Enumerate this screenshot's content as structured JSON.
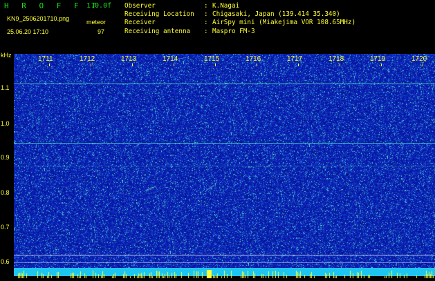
{
  "app": {
    "title": "H R O F F T",
    "version": "1.0.0f",
    "filename": "KN9_2506201710.png",
    "mode": "meteor",
    "datetime": "25.06.20 17:10",
    "count": "97"
  },
  "info": [
    {
      "key": "Observer",
      "sep": ":",
      "value": "K.Nagai"
    },
    {
      "key": "Receiving Location",
      "sep": ":",
      "value": "Chigasaki, Japan (139.414 35.340)"
    },
    {
      "key": "Receiver",
      "sep": ":",
      "value": "AirSpy mini (Miakejima VOR 108.65MHz)"
    },
    {
      "key": "Receiving antenna",
      "sep": ":",
      "value": "Maspro FM-3"
    }
  ],
  "axis": {
    "unit": "kHz",
    "yticks": [
      "1.1",
      "1.0",
      "0.9",
      "0.8",
      "0.7",
      "0.6"
    ],
    "time_labels": [
      "1711",
      "1712",
      "1713",
      "1714",
      "1715",
      "1716",
      "1717",
      "1718",
      "1719",
      "1720"
    ]
  },
  "colors": {
    "background": "#000000",
    "plot": "#0a1fb8",
    "label": "#ffff33",
    "title": "#19e019",
    "bar": "#1dc5f0"
  }
}
